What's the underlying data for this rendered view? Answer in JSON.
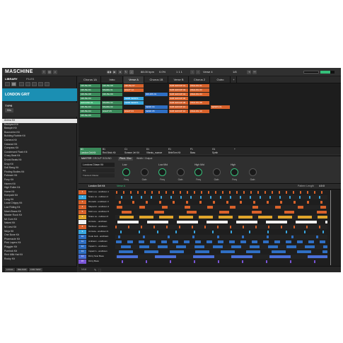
{
  "app": {
    "name": "MASCHINE"
  },
  "transport": {
    "tempo": "88.00",
    "bpm_label": "bpm",
    "swing": "0.0",
    "swing_unit": "%",
    "bar_beat": "1 1 1",
    "scene": "Verse 4",
    "page": "1/8"
  },
  "browser": {
    "tabs": [
      "LIBRARY",
      "FILES"
    ],
    "crumb": "LONDON GRIT",
    "type_label": "TYPE",
    "type_chip": "Kits",
    "kits": [
      "Anima Kit",
      "Backyard Kit",
      "Basspin Kit",
      "Bounceinn Kit",
      "Building Rubble Kit",
      "Camera Kit",
      "Cataract Kit",
      "Compass Kit",
      "Condensed Flash Kit",
      "Crazy Beat Kit",
      "Drunk Beats Kit",
      "Drop Kit",
      "Dull Bang Kit",
      "Finding Bodies Kit",
      "Follower Kit",
      "Funy Kit",
      "Harem Kit",
      "High Roller Kit",
      "Home Kit",
      "Kompakt Kit",
      "Long Kit",
      "Local Chippy Kit",
      "Low Riding Kit",
      "Mash Brass Kit",
      "Master Rock Kit",
      "Mr Gum Kit",
      "Naked Kit",
      "Ni Ltest Kit",
      "Ninja Kit",
      "One Bone Kit",
      "Pharmacie Kit",
      "Pink Layers Kit",
      "Plaggler Kit",
      "Pumhok Kit",
      "Rich Milk Hat Kit",
      "Rocky Kit"
    ],
    "selected_index": 0,
    "footer": [
      "LOCAL",
      "RELOAD",
      "FOR TEST"
    ]
  },
  "arranger": {
    "sections": [
      "Chorus 1A",
      "Intro",
      "Verse A",
      "Chorus 1B",
      "Verse B",
      "Chorus 2",
      "Outro"
    ],
    "active_section": 2,
    "rows": [
      [
        "CRUSH 06",
        "CRUSH 08",
        "CRUSH 07",
        "",
        "SUB GROUP 01",
        "ANALOG 01",
        ""
      ],
      [
        "CRUSH 01",
        "SNARE 01",
        "HIHAT 1A",
        "",
        "SUB GROUP 03",
        "ANALOG 03",
        ""
      ],
      [
        "CRUSH 08",
        "CRUSH 09",
        "",
        "DRUMS 01",
        "SUB GROUP 04",
        "ANALOG 04",
        ""
      ],
      [
        "CRUSH 03",
        "",
        "VERB SENDS",
        "",
        "SUB GROUP 06",
        "",
        ""
      ],
      [
        "GROUND 01",
        "SNARE 02",
        "VERB SENDS",
        "",
        "SUB GROUP 08",
        "ANALOG 08",
        ""
      ],
      [
        "CRUSH 04",
        "SNARE 03",
        "",
        "SEND 04",
        "SUB GROUP 10",
        "",
        "SENDS 01"
      ],
      [
        "CRUSH 04",
        "HIHAT 05",
        "HIHAT 03",
        "SEND 05",
        "SUB GROUP 10",
        "ANALOG 10",
        ""
      ],
      [
        "CRUSH 05",
        "",
        "",
        "",
        "",
        "",
        ""
      ]
    ],
    "groups": [
      {
        "id": "A1",
        "name": "London Grit Kit"
      },
      {
        "id": "B1",
        "name": "Red Brick Kit"
      },
      {
        "id": "C1",
        "name": "Scream Jet Kit"
      },
      {
        "id": "D1",
        "name": "Vibrato_nuance"
      },
      {
        "id": "E1",
        "name": "BriteTom Kit"
      },
      {
        "id": "F1",
        "name": "Bass"
      },
      {
        "id": "G1",
        "name": "Synth"
      }
    ]
  },
  "control": {
    "tabs": [
      "MASTER",
      "GROUP",
      "SOUND"
    ],
    "page_tabs": [
      "Pitch / Env",
      "Width / Output"
    ],
    "sound": "Londons Dlawn Kit",
    "slots": [
      "EQ",
      "Transient Master"
    ],
    "param_groups": [
      "Low",
      "Low Mid",
      "High Mid",
      "High"
    ],
    "knobs": [
      "Freq",
      "Gain",
      "Freq",
      "Gain",
      "Freq",
      "Gain",
      "Freq",
      "Gain"
    ]
  },
  "pattern": {
    "group_name": "London Grit Kit",
    "pattern_name": "Verse A",
    "length_label": "Pattern Length",
    "length": "4:0:0",
    "rows": [
      {
        "n": "1",
        "name": "Kick Lou...unsDown 1"
      },
      {
        "n": "2",
        "name": "Snare Lo...nsDown 2"
      },
      {
        "n": "3",
        "name": "DroneHi...unsDown 3"
      },
      {
        "n": "4",
        "name": "SlaperHi...unsDown 4"
      },
      {
        "n": "5",
        "name": "Kick Lou...unsDown 5"
      },
      {
        "n": "6",
        "name": "Snare Lo...nsDown 6"
      },
      {
        "n": "7",
        "name": "Unmute ...unsDown"
      },
      {
        "n": "8",
        "name": "Tambour...unsDown"
      },
      {
        "n": "9",
        "name": "Unmute...unsDown 9"
      },
      {
        "n": "10",
        "name": "Cook Guit...unsDown"
      },
      {
        "n": "11",
        "name": "Ambienc...unsDown"
      },
      {
        "n": "12",
        "name": "Impact 1...unsDown"
      },
      {
        "n": "13",
        "name": "Impact 1...unsDown"
      },
      {
        "n": "14",
        "name": "Dizzy Scar Bass"
      },
      {
        "n": "15",
        "name": "Dizzy Bass"
      }
    ],
    "footer_label": "1:14"
  },
  "colors": {
    "accent": "#1b8fb3",
    "green": "#35c07a",
    "cell_green": "#3a8a5a",
    "cell_blue": "#2f6fc4",
    "orange": "#d9622b",
    "light_blue": "#39a7e0"
  }
}
